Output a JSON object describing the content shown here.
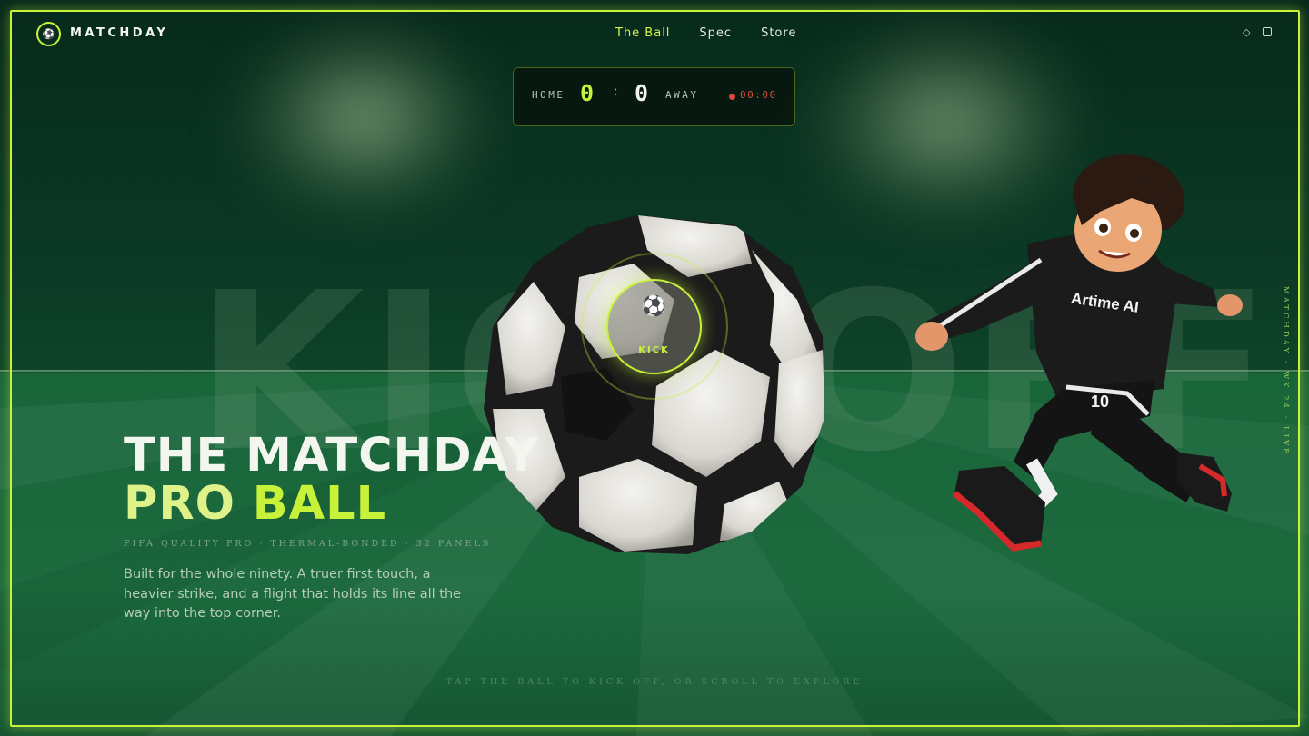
{
  "brand": {
    "logo_icon": "ball-icon",
    "name": "MATCHDAY"
  },
  "nav": {
    "items": [
      {
        "label": "The Ball",
        "active": true
      },
      {
        "label": "Spec",
        "active": false
      },
      {
        "label": "Store",
        "active": false
      }
    ],
    "icons": [
      "diamond-icon",
      "square-icon"
    ]
  },
  "scoreboard": {
    "home_label": "HOME",
    "home_score": "0",
    "separator": ":",
    "away_score": "0",
    "away_label": "AWAY",
    "time": "00:00"
  },
  "watermark": "KICKOFF",
  "kick_button": {
    "icon": "ball-icon",
    "label": "KICK"
  },
  "hero": {
    "title_line1": "THE MATCHDAY",
    "title_line2_part1": "PRO ",
    "title_line2_part2": "BALL",
    "spec": "FIFA QUALITY PRO · THERMAL-BONDED · 32 PANELS",
    "description": "Built for the whole ninety. A truer first touch, a heavier strike, and a flight that holds its line all the way into the top corner."
  },
  "hint": "TAP THE BALL TO KICK OFF, OR SCROLL TO EXPLORE",
  "side_label": "MATCHDAY · WK 24 · LIVE",
  "player": {
    "hoodie_text": "Artime AI",
    "number": "10"
  },
  "colors": {
    "accent": "#c8f23a",
    "live": "#e0473a",
    "pitch": "#1c6a3e",
    "sky": "#072a1b"
  }
}
